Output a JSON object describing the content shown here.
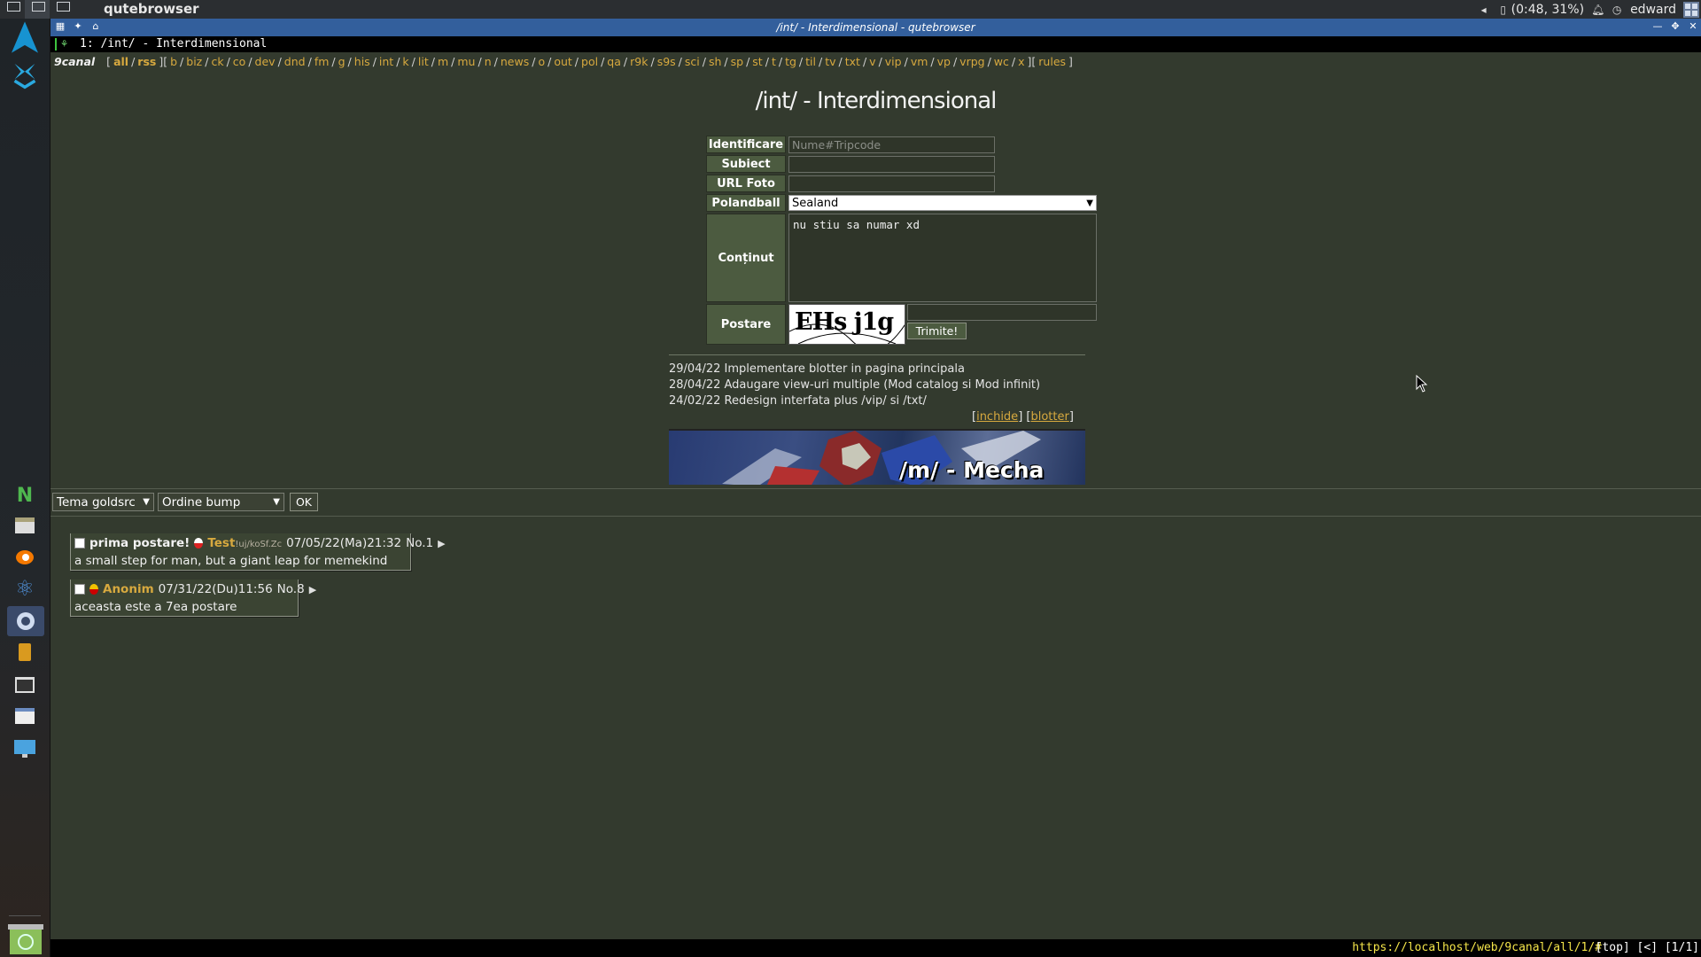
{
  "topbar": {
    "app_name": "qutebrowser",
    "battery": "(0:48, 31%)",
    "user": "edward"
  },
  "window": {
    "title": "/int/ - Interdimensional - qutebrowser"
  },
  "tab": {
    "label": "1: /int/ - Interdimensional"
  },
  "nav": {
    "brand": "9canal",
    "special": [
      "all",
      "rss"
    ],
    "boards": [
      "b",
      "biz",
      "ck",
      "co",
      "dev",
      "dnd",
      "fm",
      "g",
      "his",
      "int",
      "k",
      "lit",
      "m",
      "mu",
      "n",
      "news",
      "o",
      "out",
      "pol",
      "qa",
      "r9k",
      "s9s",
      "sci",
      "sh",
      "sp",
      "st",
      "t",
      "tg",
      "til",
      "tv",
      "txt",
      "v",
      "vip",
      "vm",
      "vp",
      "vrpg",
      "wc",
      "x"
    ],
    "rules": "rules"
  },
  "board": {
    "title": "/int/ - Interdimensional"
  },
  "form": {
    "name_label": "Identificare",
    "name_placeholder": "Nume#Tripcode",
    "subject_label": "Subiect",
    "url_label": "URL Foto",
    "flag_label": "Polandball",
    "flag_value": "Sealand",
    "content_label": "Conținut",
    "content_value": "nu stiu sa numar xd",
    "post_label": "Postare",
    "captcha_text": "EHs j1g",
    "submit_label": "Trimite!"
  },
  "blotter": {
    "entries": [
      "29/04/22 Implementare blotter in pagina principala",
      "28/04/22 Adaugare view-uri multiple (Mod catalog si Mod infinit)",
      "24/02/22 Redesign interfata plus /vip/ si /txt/"
    ],
    "close_label": "inchide",
    "blotter_label": "blotter"
  },
  "banner": {
    "text": "/m/ - Mecha"
  },
  "controls": {
    "theme": "Tema goldsrc",
    "order": "Ordine bump",
    "ok": "OK"
  },
  "posts": [
    {
      "subject": "prima postare!",
      "name": "Test",
      "trip": "!uj/koSf.Zc",
      "date": "07/05/22(Ma)21:32",
      "number": "No.1",
      "body": "a small step for man, but a giant leap for memekind"
    },
    {
      "subject": "",
      "name": "Anonim",
      "trip": "",
      "date": "07/31/22(Du)11:56",
      "number": "No.8",
      "body": "aceasta este a 7ea postare"
    }
  ],
  "statusbar": {
    "url": "https://localhost/web/9canal/all/1/#",
    "position": "[top] [<] [1/1]"
  }
}
